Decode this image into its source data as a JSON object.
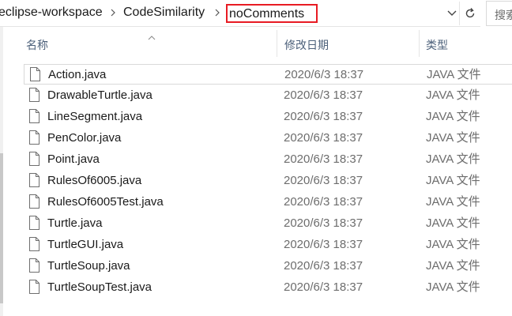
{
  "breadcrumb": {
    "items": [
      "eclipse-workspace",
      "CodeSimilarity"
    ],
    "current": "noComments"
  },
  "search": {
    "placeholder": "搜索"
  },
  "columns": {
    "name": "名称",
    "date": "修改日期",
    "type": "类型"
  },
  "files": [
    {
      "name": "Action.java",
      "date": "2020/6/3 18:37",
      "type": "JAVA 文件"
    },
    {
      "name": "DrawableTurtle.java",
      "date": "2020/6/3 18:37",
      "type": "JAVA 文件"
    },
    {
      "name": "LineSegment.java",
      "date": "2020/6/3 18:37",
      "type": "JAVA 文件"
    },
    {
      "name": "PenColor.java",
      "date": "2020/6/3 18:37",
      "type": "JAVA 文件"
    },
    {
      "name": "Point.java",
      "date": "2020/6/3 18:37",
      "type": "JAVA 文件"
    },
    {
      "name": "RulesOf6005.java",
      "date": "2020/6/3 18:37",
      "type": "JAVA 文件"
    },
    {
      "name": "RulesOf6005Test.java",
      "date": "2020/6/3 18:37",
      "type": "JAVA 文件"
    },
    {
      "name": "Turtle.java",
      "date": "2020/6/3 18:37",
      "type": "JAVA 文件"
    },
    {
      "name": "TurtleGUI.java",
      "date": "2020/6/3 18:37",
      "type": "JAVA 文件"
    },
    {
      "name": "TurtleSoup.java",
      "date": "2020/6/3 18:37",
      "type": "JAVA 文件"
    },
    {
      "name": "TurtleSoupTest.java",
      "date": "2020/6/3 18:37",
      "type": "JAVA 文件"
    }
  ],
  "icons": {
    "chevron": "chevron-right-icon",
    "dropdown": "chevron-down-icon",
    "refresh": "refresh-icon",
    "file": "file-icon",
    "sort": "sort-ascending-icon"
  },
  "colors": {
    "highlight_border": "#e81b23",
    "header_text": "#4c607a"
  }
}
